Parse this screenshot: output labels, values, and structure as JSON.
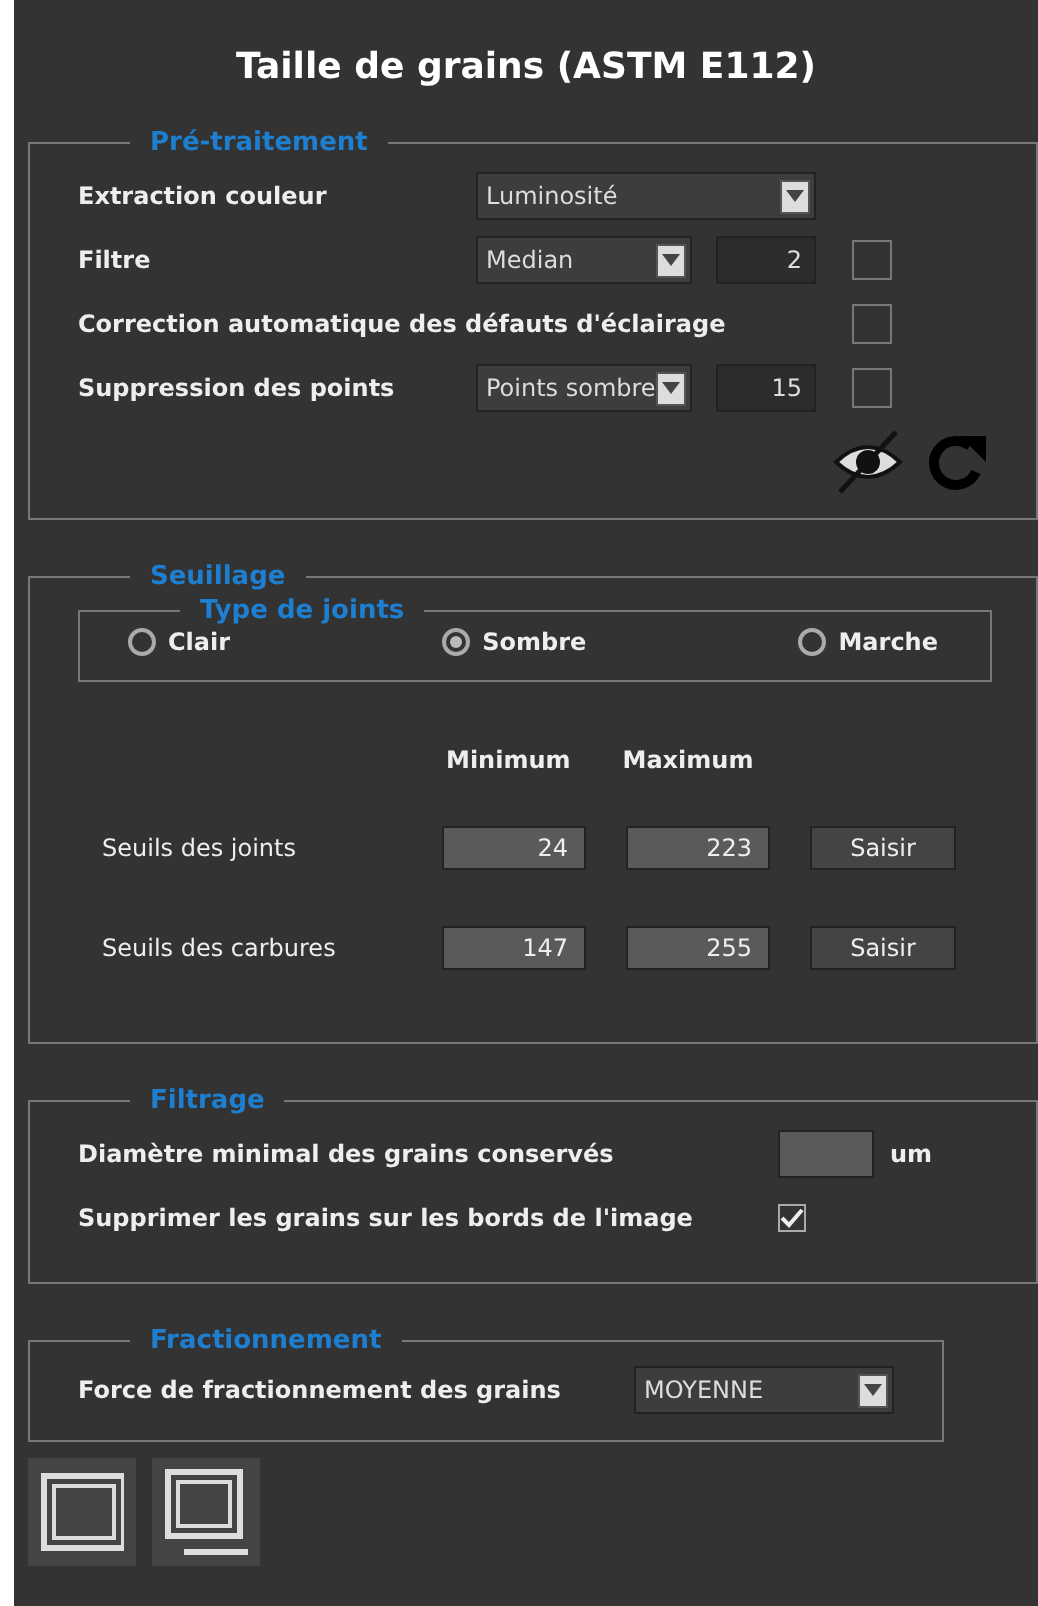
{
  "title": "Taille de grains (ASTM E112)",
  "preprocessing": {
    "title": "Pré-traitement",
    "rows": [
      {
        "kind": "select",
        "label": "Extraction couleur",
        "value": "Luminosité"
      },
      {
        "kind": "select_number",
        "label": "Filtre",
        "value": "Median",
        "number": "2",
        "checked": false
      },
      {
        "kind": "checkbox",
        "label": "Correction automatique des défauts d'éclairage",
        "checked": false
      },
      {
        "kind": "select_number",
        "label": "Suppression des points",
        "value": "Points sombre",
        "number": "15",
        "checked": false
      }
    ]
  },
  "thresholding": {
    "title": "Seuillage",
    "joint_type": {
      "title": "Type de joints",
      "options": [
        {
          "label": "Clair",
          "selected": false
        },
        {
          "label": "Sombre",
          "selected": true
        },
        {
          "label": "Marche",
          "selected": false
        }
      ]
    },
    "columns": [
      "Minimum",
      "Maximum"
    ],
    "rows": [
      {
        "label": "Seuils des joints",
        "min": "24",
        "max": "223",
        "button": "Saisir"
      },
      {
        "label": "Seuils des carbures",
        "min": "147",
        "max": "255",
        "button": "Saisir"
      }
    ]
  },
  "filtering": {
    "title": "Filtrage",
    "min_diameter": {
      "label": "Diamètre minimal des grains conservés",
      "unit": "um"
    },
    "remove_border": {
      "label": "Supprimer les grains sur les bords de l'image",
      "checked": true
    }
  },
  "fragmentation": {
    "title": "Fractionnement",
    "label": "Force de fractionnement des grains",
    "value": "MOYENNE"
  }
}
